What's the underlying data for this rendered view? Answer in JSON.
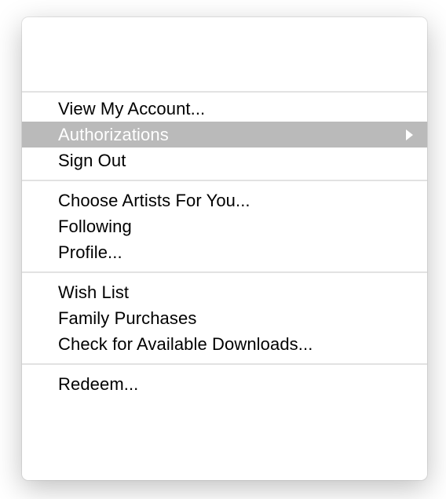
{
  "menu": {
    "sections": [
      [
        {
          "label": "View My Account...",
          "hasSubmenu": false,
          "highlighted": false
        },
        {
          "label": "Authorizations",
          "hasSubmenu": true,
          "highlighted": true
        },
        {
          "label": "Sign Out",
          "hasSubmenu": false,
          "highlighted": false
        }
      ],
      [
        {
          "label": "Choose Artists For You...",
          "hasSubmenu": false,
          "highlighted": false
        },
        {
          "label": "Following",
          "hasSubmenu": false,
          "highlighted": false
        },
        {
          "label": "Profile...",
          "hasSubmenu": false,
          "highlighted": false
        }
      ],
      [
        {
          "label": "Wish List",
          "hasSubmenu": false,
          "highlighted": false
        },
        {
          "label": "Family Purchases",
          "hasSubmenu": false,
          "highlighted": false
        },
        {
          "label": "Check for Available Downloads...",
          "hasSubmenu": false,
          "highlighted": false
        }
      ],
      [
        {
          "label": "Redeem...",
          "hasSubmenu": false,
          "highlighted": false
        }
      ]
    ]
  }
}
